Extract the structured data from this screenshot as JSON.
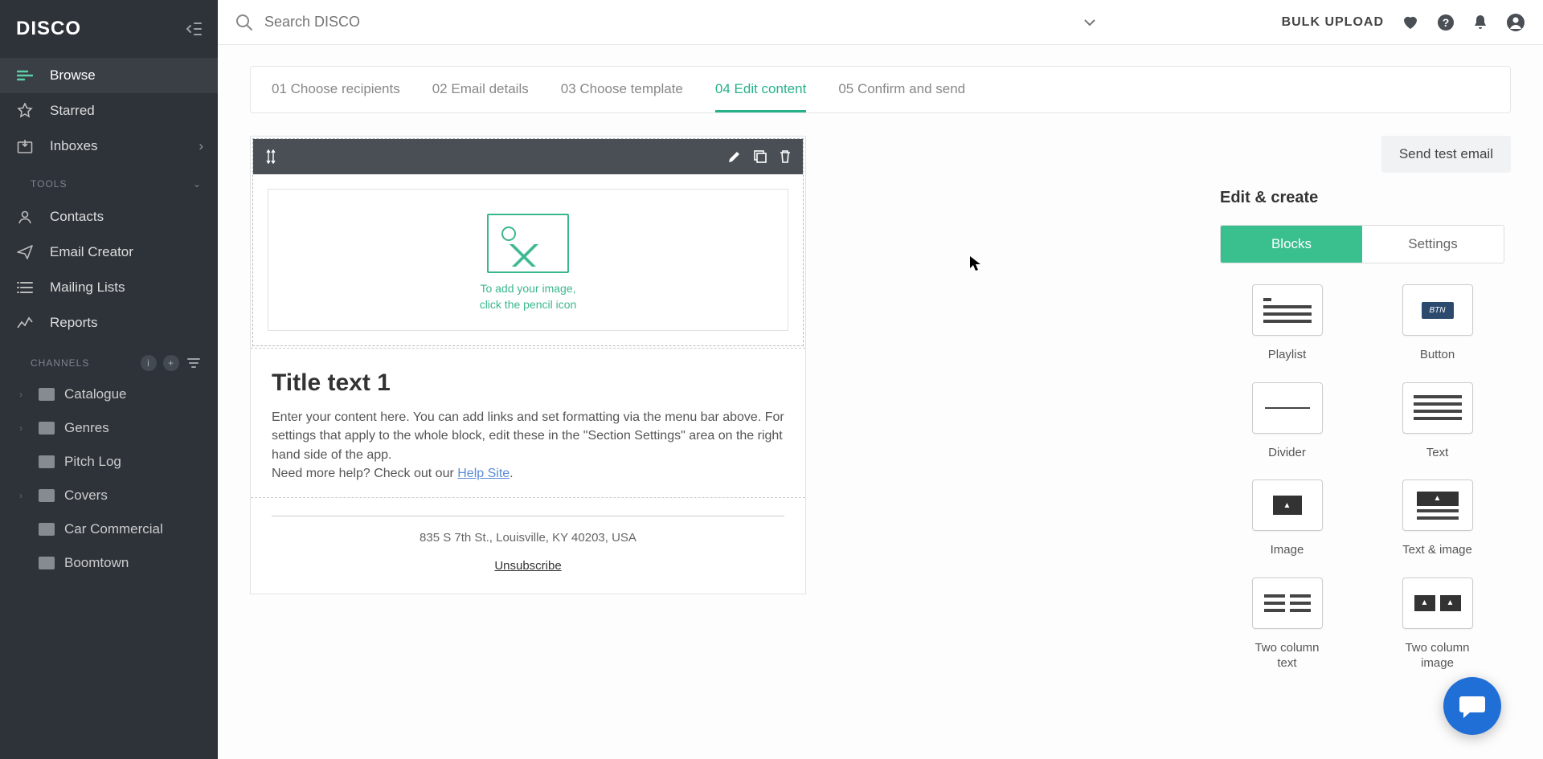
{
  "app": {
    "logo": "DISCO"
  },
  "search": {
    "placeholder": "Search DISCO"
  },
  "topbar": {
    "bulk_upload": "BULK UPLOAD"
  },
  "sidebar": {
    "nav": [
      {
        "label": "Browse",
        "active": true
      },
      {
        "label": "Starred"
      },
      {
        "label": "Inboxes",
        "chevron": true
      }
    ],
    "section_tools": "TOOLS",
    "tools": [
      {
        "label": "Contacts"
      },
      {
        "label": "Email Creator"
      },
      {
        "label": "Mailing Lists"
      },
      {
        "label": "Reports"
      }
    ],
    "section_channels": "CHANNELS",
    "channels": [
      {
        "label": "Catalogue",
        "expandable": true
      },
      {
        "label": "Genres",
        "expandable": true
      },
      {
        "label": "Pitch Log"
      },
      {
        "label": "Covers",
        "expandable": true
      },
      {
        "label": "Car Commercial"
      },
      {
        "label": "Boomtown"
      }
    ]
  },
  "wizard": {
    "steps": [
      "01 Choose recipients",
      "02 Email details",
      "03 Choose template",
      "04 Edit content",
      "05 Confirm and send"
    ],
    "active_index": 3
  },
  "canvas": {
    "image_drop_line1": "To add your image,",
    "image_drop_line2": "click the pencil icon",
    "title": "Title text 1",
    "body1": "Enter your content here. You can add links and set formatting via the menu bar above. For settings that apply to the whole block, edit these in the \"Section Settings\" area on the right hand side of the app.",
    "body2_pre": "Need more help? Check out our ",
    "body2_link": "Help Site",
    "body2_post": ".",
    "footer_address": "835 S 7th St., Louisville, KY 40203, USA",
    "unsubscribe": "Unsubscribe"
  },
  "inspector": {
    "send_test": "Send test email",
    "title": "Edit & create",
    "tab_blocks": "Blocks",
    "tab_settings": "Settings",
    "blocks": [
      "Playlist",
      "Button",
      "Divider",
      "Text",
      "Image",
      "Text & image",
      "Two column text",
      "Two column image"
    ]
  }
}
